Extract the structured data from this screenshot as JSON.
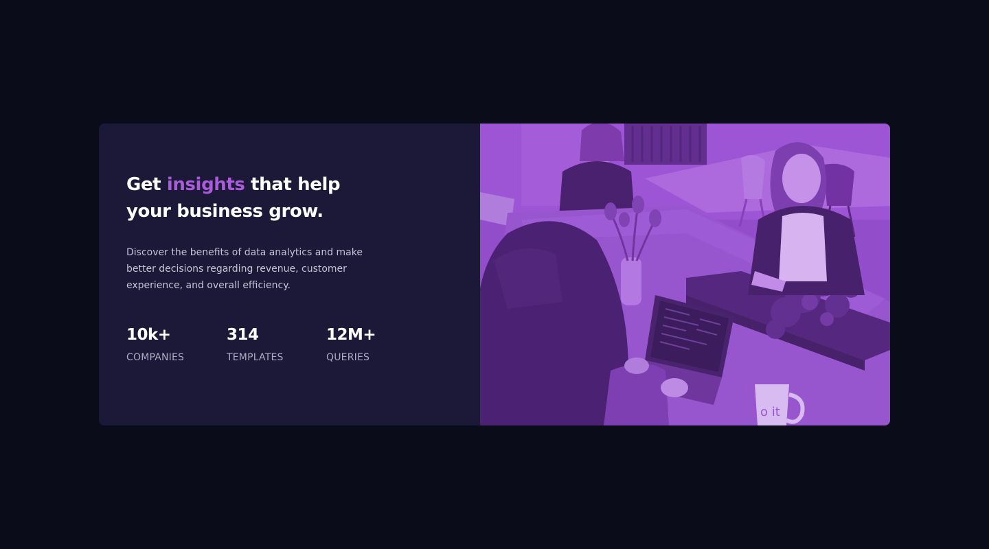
{
  "hero": {
    "headline_pre": "Get ",
    "headline_accent": "insights",
    "headline_post": " that help your business grow.",
    "description": "Discover the benefits of data analytics and make better decisions regarding revenue, customer experience, and overall efficiency.",
    "stats": [
      {
        "value": "10k+",
        "label": "COMPANIES"
      },
      {
        "value": "314",
        "label": "TEMPLATES"
      },
      {
        "value": "12M+",
        "label": "QUERIES"
      }
    ]
  },
  "image": {
    "mug_text": "o it"
  },
  "colors": {
    "page_background": "#0a0c1a",
    "card_background": "#1b1937",
    "accent": "#aa5cdb",
    "image_tint": "#8c45c4"
  }
}
